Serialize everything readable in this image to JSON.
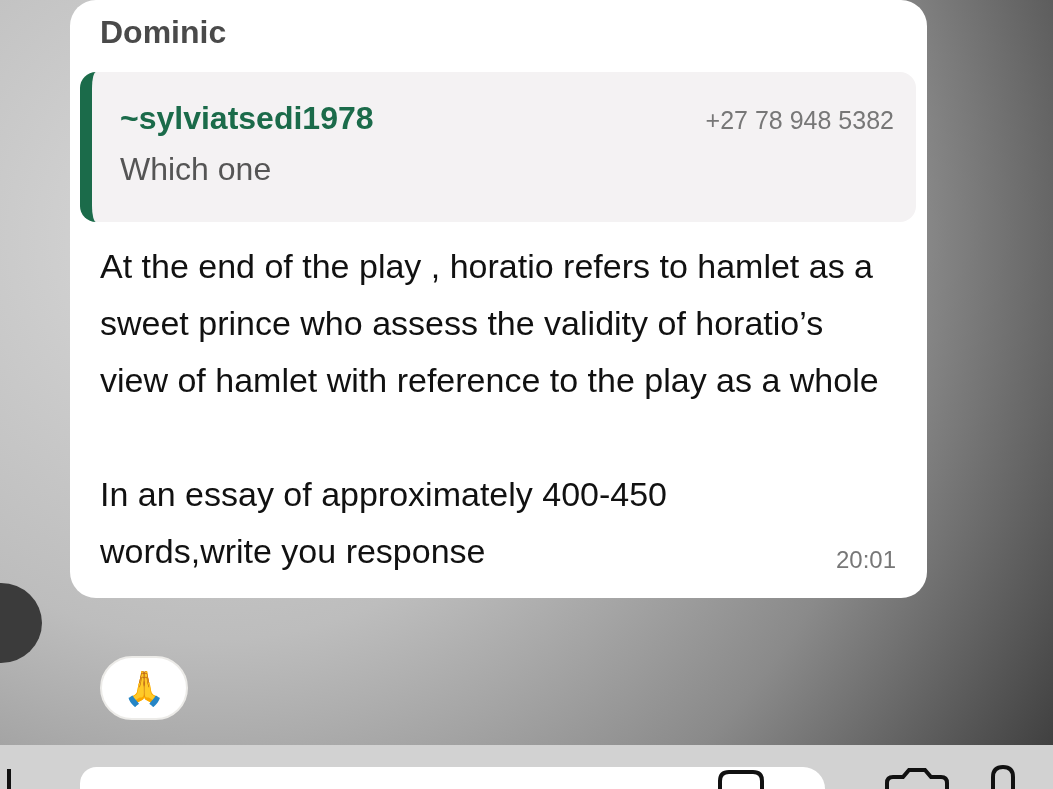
{
  "message": {
    "sender": "Dominic",
    "quote": {
      "author": "~sylviatsedi1978",
      "phone": "+27 78 948 5382",
      "text": "Which one"
    },
    "paragraphs": [
      "At the end of the play , horatio refers to hamlet as a sweet prince who assess the validity of horatio’s view of hamlet with reference to the play as a whole",
      "In an essay of approximately 400-450 words,write you response"
    ],
    "time": "20:01",
    "reaction": "🙏"
  }
}
